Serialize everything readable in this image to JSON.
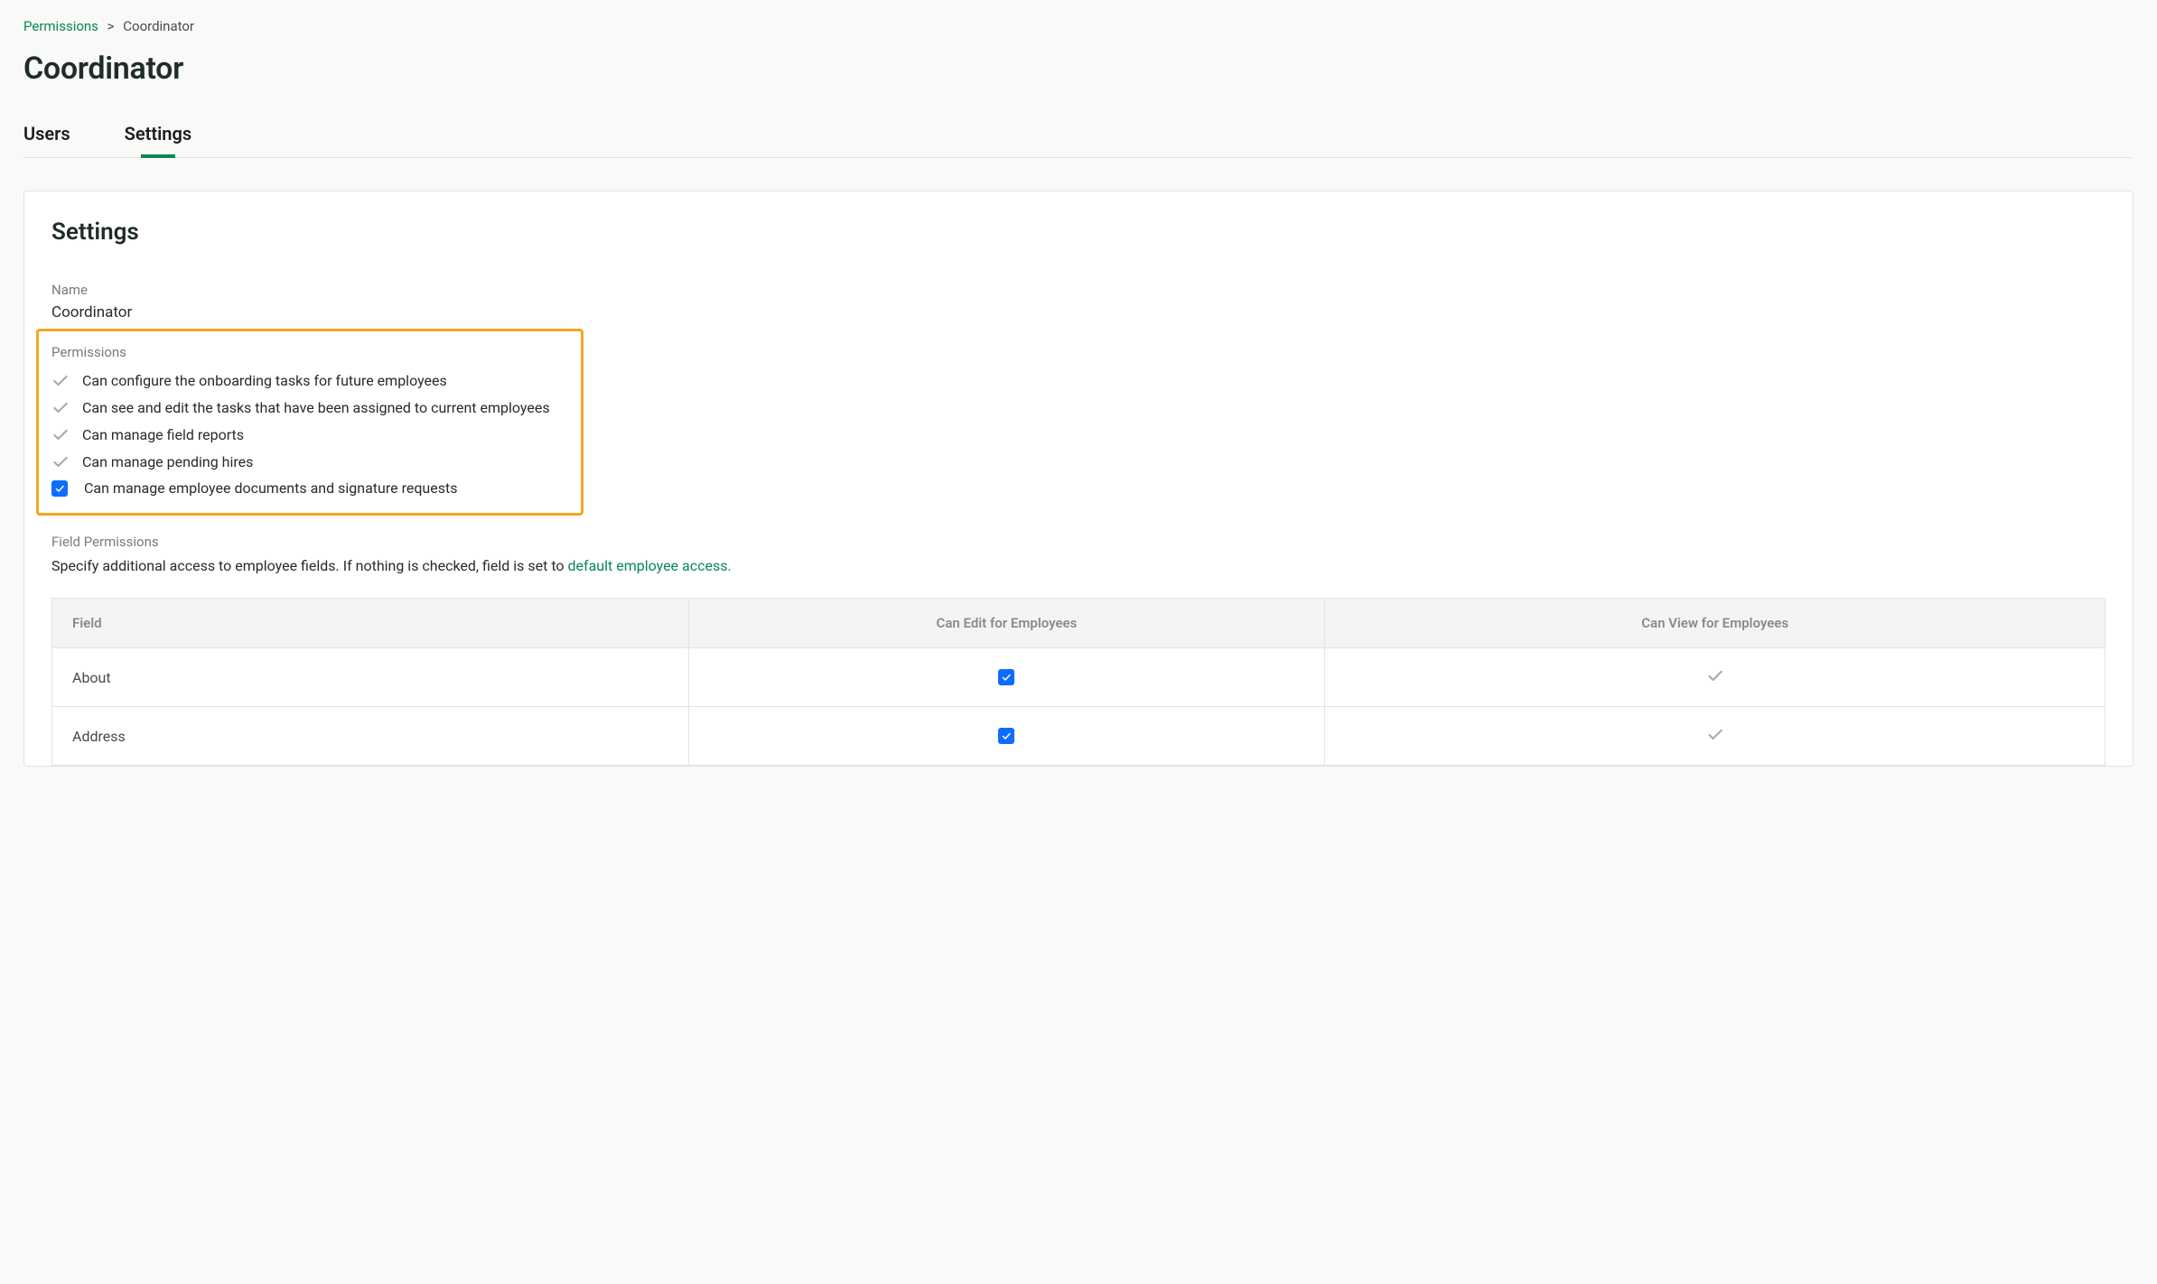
{
  "breadcrumb": {
    "root": "Permissions",
    "current": "Coordinator"
  },
  "page_title": "Coordinator",
  "tabs": {
    "users": "Users",
    "settings": "Settings"
  },
  "panel": {
    "title": "Settings",
    "name_label": "Name",
    "name_value": "Coordinator",
    "permissions_label": "Permissions",
    "permissions": [
      {
        "label": "Can configure the onboarding tasks for future employees",
        "state": "locked"
      },
      {
        "label": "Can see and edit the tasks that have been assigned to current employees",
        "state": "locked"
      },
      {
        "label": "Can manage field reports",
        "state": "locked"
      },
      {
        "label": "Can manage pending hires",
        "state": "locked"
      },
      {
        "label": "Can manage employee documents and signature requests",
        "state": "checked"
      }
    ],
    "field_permissions_label": "Field Permissions",
    "field_permissions_desc_prefix": "Specify additional access to employee fields. If nothing is checked, field is set to ",
    "field_permissions_desc_link": "default employee access.",
    "table": {
      "headers": {
        "field": "Field",
        "can_edit": "Can Edit for Employees",
        "can_view": "Can View for Employees"
      },
      "rows": [
        {
          "field": "About",
          "edit": "checked",
          "view": "locked"
        },
        {
          "field": "Address",
          "edit": "checked",
          "view": "locked"
        }
      ]
    }
  }
}
